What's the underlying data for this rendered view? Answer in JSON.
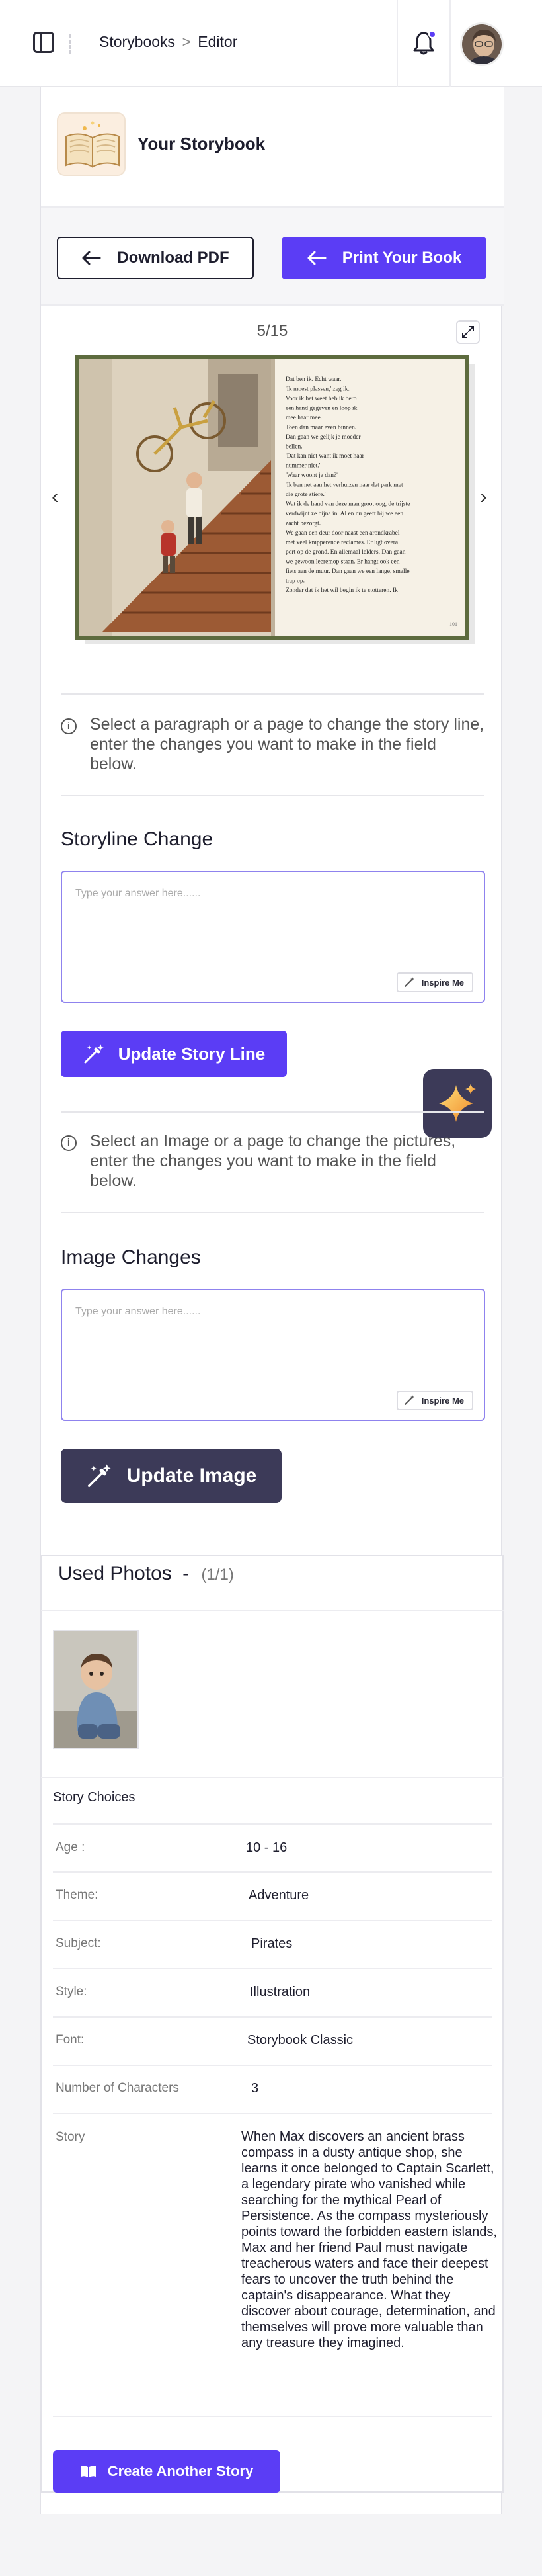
{
  "topbar": {
    "breadcrumb_root": "Storybooks",
    "breadcrumb_sep": ">",
    "breadcrumb_current": "Editor"
  },
  "storybook": {
    "title": "Your Storybook",
    "download_label": "Download PDF",
    "print_label": "Print Your Book"
  },
  "viewer": {
    "page_indicator": "5/15",
    "book_page_text": [
      "Dat ben ik. Echt waar.",
      "'Ik moest plassen,' zeg ik.",
      "Voor ik het weet heb ik bero",
      "een hand gegeven en loop ik",
      "mee haar mee.",
      "Toen dan maar even binnen.",
      "Dan gaan we gelijk je moeder",
      "bellen.",
      "'Dat kan niet want ik moet haar",
      "nummer niet.'",
      "'Waar woont je dan?'",
      "'Ik ben net aan het verhuizen naar dat park met",
      "die grote stiere.'",
      "Wat ik de hand van deze man groot oog, de trijste",
      "verdwijnt ze bijna in. Al en nu geeft bij we een",
      "zacht bezorgt.",
      "We gaan een deur door naast een arondkrabel",
      "met veel knipperende reclames. Er ligt overal",
      "port op de grond. En allemaal lelders. Dan gaan",
      "we gewoon leeremop staan. Er hangt ook een",
      "fiets aan de muur. Dan gaan we een lange, smalle",
      "trap op.",
      "Zonder dat ik het wil begin ik te stotteren. Ik"
    ],
    "book_page_number": "101"
  },
  "storyline": {
    "hint": "Select a paragraph or a page to change the story line, enter the changes you want to make in the field below.",
    "title": "Storyline Change",
    "placeholder": "Type your answer here......",
    "inspire_label": "Inspire Me",
    "update_label": "Update Story Line"
  },
  "image_changes": {
    "hint": "Select an Image or a page to change the pictures, enter the changes you want to make in the field below.",
    "title": "Image Changes",
    "placeholder": "Type your answer here......",
    "inspire_label": "Inspire Me",
    "update_label": "Update Image"
  },
  "used_photos": {
    "title": "Used Photos",
    "dash": "-",
    "count": "(1/1)"
  },
  "story_choices": {
    "title": "Story Choices",
    "rows": [
      {
        "label": "Age :",
        "value": "10 - 16"
      },
      {
        "label": "Theme:",
        "value": "Adventure"
      },
      {
        "label": "Subject:",
        "value": "Pirates"
      },
      {
        "label": "Style:",
        "value": "Illustration"
      },
      {
        "label": "Font:",
        "value": "Storybook Classic"
      },
      {
        "label": "Number of Characters",
        "value": "3"
      }
    ],
    "story_label": "Story",
    "story_text": "When Max discovers an ancient brass compass in a dusty antique shop, she learns it once belonged to Captain Scarlett, a legendary pirate who vanished while searching for the mythical Pearl of Persistence. As the compass mysteriously points toward the forbidden eastern islands, Max and her friend Paul must navigate treacherous waters and face their deepest fears to uncover the truth behind the captain's disappearance. What they discover about courage, determination, and themselves will prove more valuable than any treasure they imagined."
  },
  "footer": {
    "create_label": "Create Another Story"
  },
  "colors": {
    "accent": "#5b3df5",
    "dark_button": "#3c3a58",
    "textarea_border": "#8f83ee"
  },
  "icons": [
    "sidebar-toggle-icon",
    "bell-icon",
    "arrow-left-icon",
    "expand-icon",
    "chevron-left-icon",
    "chevron-right-icon",
    "info-icon",
    "magic-wand-icon",
    "sparkles-icon",
    "book-open-icon"
  ]
}
